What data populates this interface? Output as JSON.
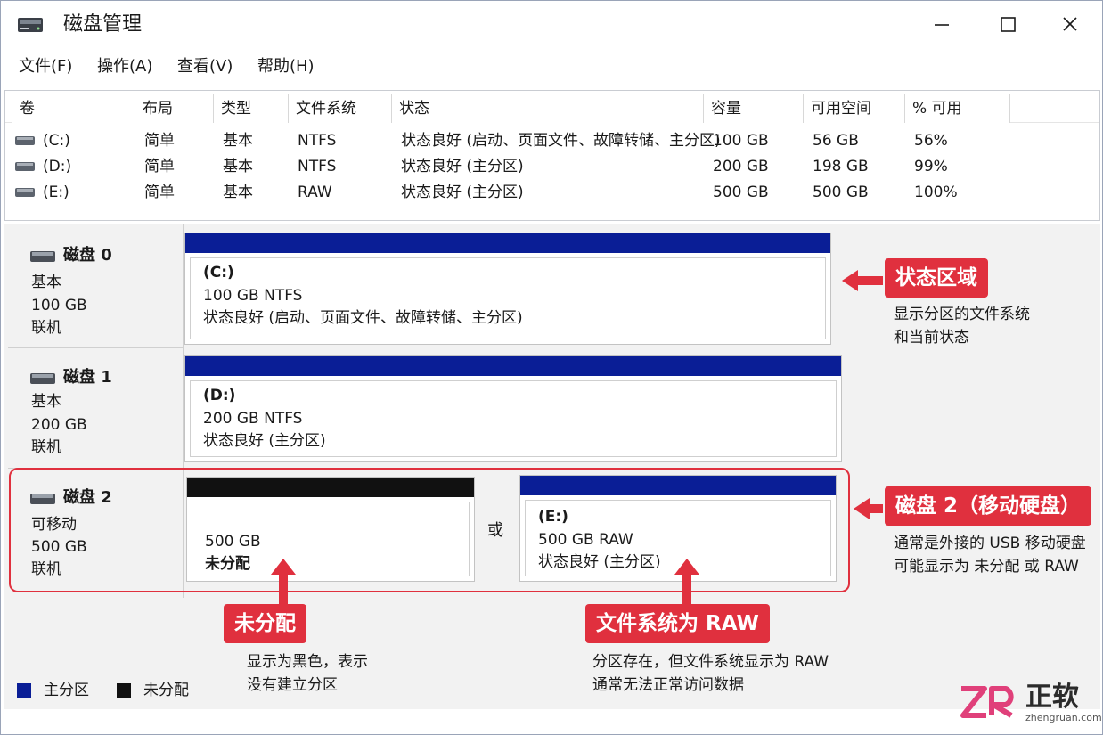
{
  "window": {
    "title": "磁盘管理",
    "icon": "disk-management-icon",
    "controls": [
      "minimize-icon",
      "maximize-icon",
      "close-icon"
    ]
  },
  "menu": {
    "file": "文件(F)",
    "action": "操作(A)",
    "view": "查看(V)",
    "help": "帮助(H)"
  },
  "volume_list": {
    "headers": {
      "volume": "卷",
      "layout": "布局",
      "type": "类型",
      "fs": "文件系统",
      "status": "状态",
      "capacity": "容量",
      "free": "可用空间",
      "pct": "% 可用"
    },
    "rows": [
      {
        "volume": "(C:)",
        "layout": "简单",
        "type": "基本",
        "fs": "NTFS",
        "status": "状态良好 (启动、页面文件、故障转储、主分区)",
        "capacity": "100 GB",
        "free": "56 GB",
        "pct": "56%"
      },
      {
        "volume": "(D:)",
        "layout": "简单",
        "type": "基本",
        "fs": "NTFS",
        "status": "状态良好 (主分区)",
        "capacity": "200 GB",
        "free": "198 GB",
        "pct": "99%"
      },
      {
        "volume": "(E:)",
        "layout": "简单",
        "type": "基本",
        "fs": "RAW",
        "status": "状态良好 (主分区)",
        "capacity": "500 GB",
        "free": "500 GB",
        "pct": "100%"
      }
    ]
  },
  "disks": [
    {
      "name": "磁盘 0",
      "kind": "基本",
      "size": "100 GB",
      "state": "联机",
      "partition": {
        "label": "(C:)",
        "detail": "100 GB NTFS",
        "status": "状态良好 (启动、页面文件、故障转储、主分区)"
      }
    },
    {
      "name": "磁盘 1",
      "kind": "基本",
      "size": "200 GB",
      "state": "联机",
      "partition": {
        "label": "(D:)",
        "detail": "200 GB NTFS",
        "status": "状态良好 (主分区)"
      }
    },
    {
      "name": "磁盘 2",
      "kind": "可移动",
      "size": "500 GB",
      "state": "联机",
      "unallocated": {
        "size": "500 GB",
        "label": "未分配"
      },
      "or": "或",
      "partition": {
        "label": "(E:)",
        "detail": "500 GB RAW",
        "status": "状态良好 (主分区)"
      }
    }
  ],
  "annotations": {
    "status_area": {
      "title": "状态区域",
      "lines": [
        "显示分区的文件系统",
        "和当前状态"
      ]
    },
    "disk2": {
      "title": "磁盘 2（移动硬盘）",
      "lines": [
        "通常是外接的 USB 移动硬盘",
        "可能显示为 未分配 或 RAW"
      ]
    },
    "unallocated": {
      "title": "未分配",
      "lines": [
        "显示为黑色，表示",
        "没有建立分区"
      ]
    },
    "raw": {
      "title": "文件系统为 RAW",
      "lines": [
        "分区存在，但文件系统显示为 RAW",
        "通常无法正常访问数据"
      ]
    }
  },
  "legend": {
    "primary": {
      "label": "主分区",
      "color": "#0a1e96"
    },
    "unallocated": {
      "label": "未分配",
      "color": "#111111"
    }
  },
  "watermark": {
    "brand": "正软",
    "site": "zhengruan.com",
    "logo": "zr-logo"
  },
  "colors": {
    "primary_bar": "#0a1e96",
    "unallocated_bar": "#111111",
    "accent": "#e0303e"
  }
}
